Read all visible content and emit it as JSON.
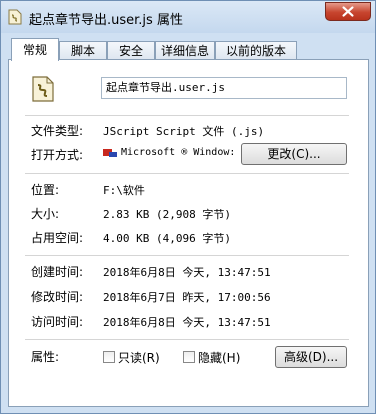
{
  "window": {
    "title": "起点章节导出.user.js 属性"
  },
  "tabs": [
    {
      "label": "常规"
    },
    {
      "label": "脚本"
    },
    {
      "label": "安全"
    },
    {
      "label": "详细信息"
    },
    {
      "label": "以前的版本"
    }
  ],
  "general": {
    "filename": "起点章节导出.user.js",
    "file_type_label": "文件类型:",
    "file_type_value": "JScript Script 文件 (.js)",
    "open_with_label": "打开方式:",
    "open_with_value": "Microsoft ® Window:",
    "change_button": "更改(C)...",
    "location_label": "位置:",
    "location_value": "F:\\软件",
    "size_label": "大小:",
    "size_value": "2.83 KB (2,908 字节)",
    "size_on_disk_label": "占用空间:",
    "size_on_disk_value": "4.00 KB (4,096 字节)",
    "created_label": "创建时间:",
    "created_value": "2018年6月8日 今天, 13:47:51",
    "modified_label": "修改时间:",
    "modified_value": "2018年6月7日 昨天, 17:00:56",
    "accessed_label": "访问时间:",
    "accessed_value": "2018年6月8日 今天, 13:47:51",
    "attributes_label": "属性:",
    "readonly_label": "只读(R)",
    "hidden_label": "隐藏(H)",
    "advanced_button": "高级(D)..."
  },
  "icons": {
    "app": "script-file-icon",
    "close": "close-icon",
    "open_with": "windows-script-host-icon"
  }
}
